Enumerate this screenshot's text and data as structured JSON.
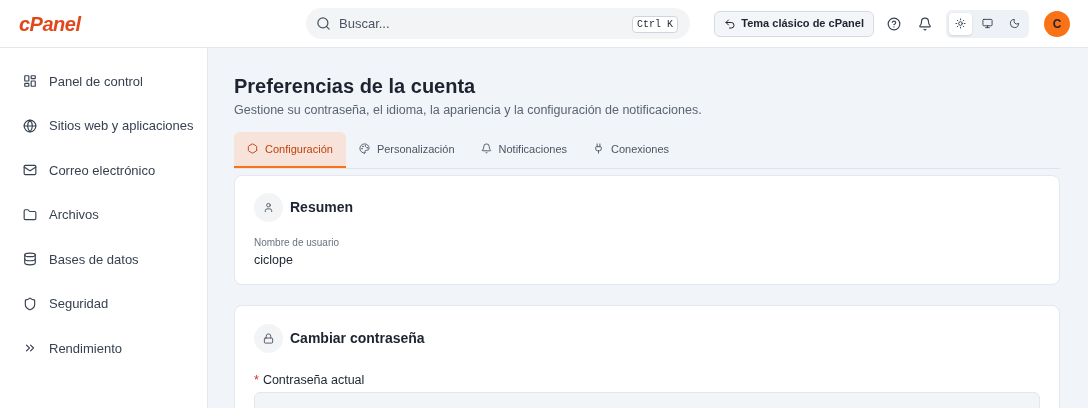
{
  "header": {
    "logo": "cPanel",
    "search": {
      "placeholder": "Buscar...",
      "shortcut": "Ctrl K"
    },
    "classic_button": "Tema clásico de cPanel",
    "theme_options": [
      {
        "kind": "light",
        "selected": true
      },
      {
        "kind": "system",
        "selected": false
      },
      {
        "kind": "dark",
        "selected": false
      }
    ],
    "avatar": "C"
  },
  "sidebar": {
    "items": [
      {
        "kind": "dashboard",
        "label": "Panel de control"
      },
      {
        "kind": "globe",
        "label": "Sitios web y aplicaciones"
      },
      {
        "kind": "mail",
        "label": "Correo electrónico"
      },
      {
        "kind": "folder",
        "label": "Archivos"
      },
      {
        "kind": "database",
        "label": "Bases de datos"
      },
      {
        "kind": "shield",
        "label": "Seguridad"
      },
      {
        "kind": "performance",
        "label": "Rendimiento"
      }
    ]
  },
  "page": {
    "title": "Preferencias de la cuenta",
    "subtitle": "Gestione su contraseña, el idioma, la apariencia y la configuración de notificaciones.",
    "tabs": [
      {
        "kind": "settings",
        "label": "Configuración",
        "selected": true
      },
      {
        "kind": "palette",
        "label": "Personalización",
        "selected": false
      },
      {
        "kind": "bell",
        "label": "Notificaciones",
        "selected": false
      },
      {
        "kind": "plug",
        "label": "Conexiones",
        "selected": false
      }
    ],
    "summary": {
      "title": "Resumen",
      "field_label": "Nombre de usuario",
      "field_value": "ciclope"
    },
    "password": {
      "title": "Cambiar contraseña",
      "required_mark": "*",
      "field_label": "Contraseña actual"
    }
  }
}
